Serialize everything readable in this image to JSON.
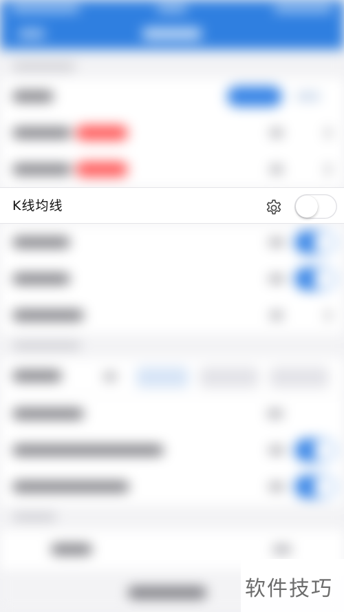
{
  "settings_row": {
    "label": "K线均线",
    "icon": "gear-icon",
    "toggle_state": "off"
  },
  "watermark": {
    "text": "软件技巧"
  },
  "colors": {
    "nav_blue": "#2f7fe0",
    "accent_blue": "#3a86e6",
    "badge_red": "#ff5a5a"
  }
}
